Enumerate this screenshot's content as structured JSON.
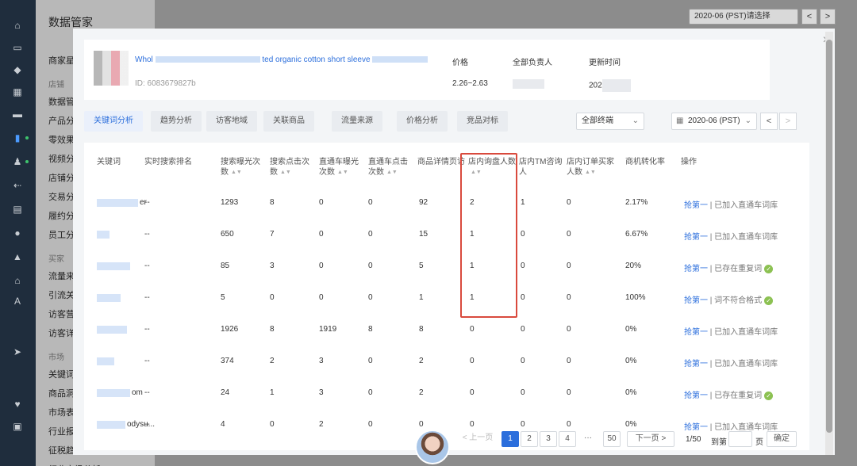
{
  "background": {
    "app_title": "数据管家",
    "nav_items": [
      "商家星",
      "店铺",
      "数据管",
      "产品分",
      "零效果",
      "视频分",
      "店铺分",
      "交易分",
      "履约分",
      "员工分",
      "买家",
      "流量来",
      "引流关",
      "访客营",
      "访客详",
      "市场",
      "关键词",
      "商品洞",
      "市场表",
      "行业报",
      "征税趋",
      "行业市场分析"
    ],
    "date_select": "2020-06 (PST)请选择",
    "prev": "<",
    "next": ">"
  },
  "modal": {
    "close": "×",
    "product": {
      "title_start": "Whol",
      "title_mid": "ted organic cotton short sleeve",
      "id": "ID: 6083679827b",
      "price_label": "价格",
      "price_value": "2.26~2.63",
      "owner_label": "全部负责人",
      "updated_label": "更新时间",
      "updated_value": "202"
    },
    "tabs": [
      "关键词分析",
      "趋势分析",
      "访客地域",
      "关联商品",
      "流量来源",
      "价格分析",
      "竞品对标"
    ],
    "terminal_select": "全部终端",
    "date_select": "2020-06 (PST)",
    "prev": "<",
    "next": ">",
    "columns": [
      "关键词",
      "实时搜索排名",
      "搜索曝光次数",
      "搜索点击次数",
      "直通车曝光次数",
      "直通车点击次数",
      "商品详情页访",
      "店内询盘人数",
      "店内TM咨询人",
      "店内订单买家人数",
      "商机转化率",
      "操作"
    ],
    "rows": [
      {
        "kw_tail": "er",
        "rank": "--",
        "c1": "1293",
        "c2": "8",
        "c3": "0",
        "c4": "0",
        "c5": "92",
        "c6": "2",
        "c7": "1",
        "c8": "0",
        "rate": "2.17%",
        "op_link": "抢第一",
        "op_sep": " | ",
        "op_text": "已加入直通车词库",
        "op_ok": false
      },
      {
        "kw_tail": "",
        "rank": "--",
        "c1": "650",
        "c2": "7",
        "c3": "0",
        "c4": "0",
        "c5": "15",
        "c6": "1",
        "c7": "0",
        "c8": "0",
        "rate": "6.67%",
        "op_link": "抢第一",
        "op_sep": " | ",
        "op_text": "已加入直通车词库",
        "op_ok": false
      },
      {
        "kw_tail": "",
        "rank": "--",
        "c1": "85",
        "c2": "3",
        "c3": "0",
        "c4": "0",
        "c5": "5",
        "c6": "1",
        "c7": "0",
        "c8": "0",
        "rate": "20%",
        "op_link": "抢第一",
        "op_sep": " | ",
        "op_text": "已存在重复词",
        "op_ok": true
      },
      {
        "kw_tail": "",
        "rank": "--",
        "c1": "5",
        "c2": "0",
        "c3": "0",
        "c4": "0",
        "c5": "1",
        "c6": "1",
        "c7": "0",
        "c8": "0",
        "rate": "100%",
        "op_link": "抢第一",
        "op_sep": " | ",
        "op_text": "词不符合格式",
        "op_ok": true
      },
      {
        "kw_tail": "",
        "rank": "--",
        "c1": "1926",
        "c2": "8",
        "c3": "1919",
        "c4": "8",
        "c5": "8",
        "c6": "0",
        "c7": "0",
        "c8": "0",
        "rate": "0%",
        "op_link": "抢第一",
        "op_sep": " | ",
        "op_text": "已加入直通车词库",
        "op_ok": false
      },
      {
        "kw_tail": "",
        "rank": "--",
        "c1": "374",
        "c2": "2",
        "c3": "3",
        "c4": "0",
        "c5": "2",
        "c6": "0",
        "c7": "0",
        "c8": "0",
        "rate": "0%",
        "op_link": "抢第一",
        "op_sep": " | ",
        "op_text": "已加入直通车词库",
        "op_ok": false
      },
      {
        "kw_tail": "om",
        "rank": "--",
        "c1": "24",
        "c2": "1",
        "c3": "3",
        "c4": "0",
        "c5": "2",
        "c6": "0",
        "c7": "0",
        "c8": "0",
        "rate": "0%",
        "op_link": "抢第一",
        "op_sep": " | ",
        "op_text": "已存在重复词",
        "op_ok": true
      },
      {
        "kw_tail": "odysu...",
        "rank": "--",
        "c1": "4",
        "c2": "0",
        "c3": "2",
        "c4": "0",
        "c5": "0",
        "c6": "0",
        "c7": "0",
        "c8": "0",
        "rate": "0%",
        "op_link": "抢第一",
        "op_sep": " | ",
        "op_text": "已加入直通车词库",
        "op_ok": false
      }
    ],
    "pager": {
      "prev": "< 上一页",
      "pages": [
        "1",
        "2",
        "3",
        "4",
        "···",
        "50"
      ],
      "next": "下一页 >",
      "total": "1/50",
      "goto_label": "到第",
      "page_unit": "页",
      "confirm": "确定"
    }
  }
}
